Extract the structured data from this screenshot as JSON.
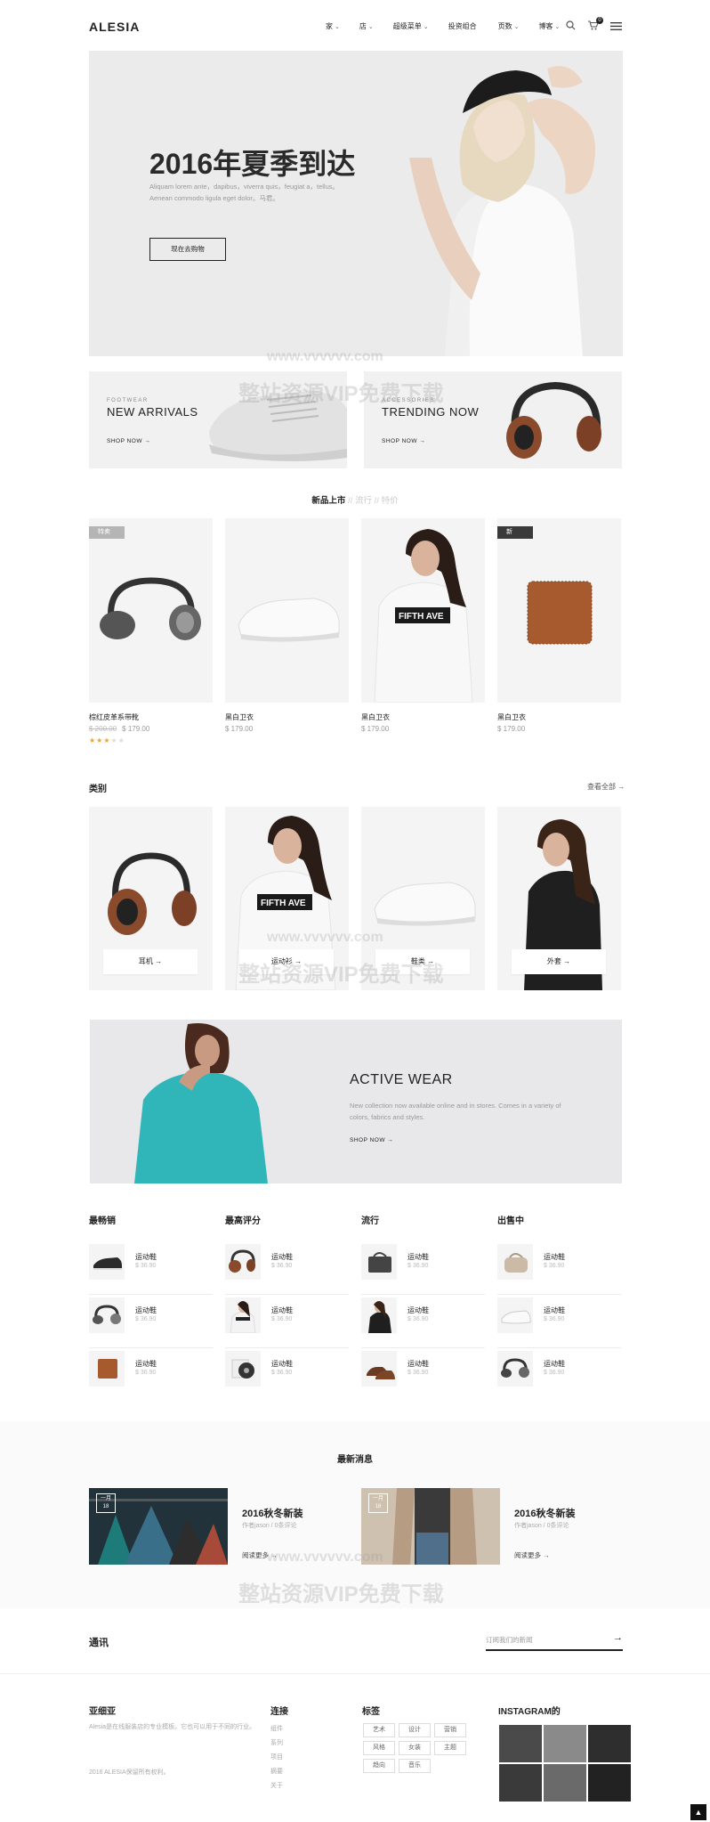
{
  "header": {
    "logo": "ALESIA",
    "nav": [
      {
        "label": "家",
        "caret": "⌄"
      },
      {
        "label": "店",
        "caret": "⌄"
      },
      {
        "label": "超级菜单",
        "caret": "⌄"
      },
      {
        "label": "投资组合",
        "caret": ""
      },
      {
        "label": "页数",
        "caret": "⌄"
      },
      {
        "label": "博客",
        "caret": "⌄"
      }
    ],
    "cart_count": "0"
  },
  "hero": {
    "title": "2016年夏季到达",
    "text": "Aliquam lorem ante，dapibus，viverra quis，feugiat a，tellus。Aenean commodo ligula eget dolor。马君。",
    "button": "现在去购物"
  },
  "banners": [
    {
      "small": "FOOTWEAR",
      "title": "NEW ARRIVALS",
      "shop": "SHOP NOW →"
    },
    {
      "small": "ACCESSORIES",
      "title": "TRENDING NOW",
      "shop": "SHOP NOW →"
    }
  ],
  "product_tabs": {
    "active": "新品上市",
    "sep1": "//",
    "tab2": "流行",
    "sep2": "//",
    "tab3": "特价"
  },
  "products": [
    {
      "tag": "特卖",
      "tag_color": "#b5b5b5",
      "name": "棕红皮革系带靴",
      "old_price": "$ 200.00",
      "price": "$ 179.00",
      "rating": 3
    },
    {
      "tag": "",
      "name": "黑白卫衣",
      "old_price": "",
      "price": "$ 179.00"
    },
    {
      "tag": "",
      "name": "黑白卫衣",
      "old_price": "",
      "price": "$ 179.00"
    },
    {
      "tag": "新",
      "tag_color": "#3a3a3a",
      "name": "黑白卫衣",
      "old_price": "",
      "price": "$ 179.00"
    }
  ],
  "categories": {
    "title": "类别",
    "view_all": "查看全部 →",
    "items": [
      {
        "label": "耳机  →"
      },
      {
        "label": "运动衫  →"
      },
      {
        "label": "鞋类  →"
      },
      {
        "label": "外套  →"
      }
    ]
  },
  "active_wear": {
    "title": "ACTIVE WEAR",
    "text": "New collection now available online and in stores. Comes in a variety of colors, fabrics and styles.",
    "shop": "SHOP NOW →"
  },
  "columns": [
    {
      "title": "最畅销",
      "items": [
        {
          "name": "运动鞋",
          "price": "$ 36.90"
        },
        {
          "name": "运动鞋",
          "price": "$ 36.90"
        },
        {
          "name": "运动鞋",
          "price": "$ 36.90"
        }
      ]
    },
    {
      "title": "最高评分",
      "items": [
        {
          "name": "运动鞋",
          "price": "$ 36.90"
        },
        {
          "name": "运动鞋",
          "price": "$ 36.90"
        },
        {
          "name": "运动鞋",
          "price": "$ 36.90"
        }
      ]
    },
    {
      "title": "流行",
      "items": [
        {
          "name": "运动鞋",
          "price": "$ 36.90"
        },
        {
          "name": "运动鞋",
          "price": "$ 36.90"
        },
        {
          "name": "运动鞋",
          "price": "$ 36.90"
        }
      ]
    },
    {
      "title": "出售中",
      "items": [
        {
          "name": "运动鞋",
          "price": "$ 36.90"
        },
        {
          "name": "运动鞋",
          "price": "$ 36.90"
        },
        {
          "name": "运动鞋",
          "price": "$ 36.90"
        }
      ]
    }
  ],
  "news": {
    "title": "最新消息",
    "posts": [
      {
        "month": "一月",
        "day": "18",
        "title": "2016秋冬新装",
        "by": "作者jason / 0条评论",
        "more": "阅读更多  →"
      },
      {
        "month": "一月",
        "day": "18",
        "title": "2016秋冬新装",
        "by": "作者jason / 0条评论",
        "more": "阅读更多  →"
      }
    ]
  },
  "newsletter": {
    "title": "通讯",
    "placeholder": "订阅我们的新闻",
    "arrow": "→"
  },
  "footer": {
    "about_title": "亚细亚",
    "about_text": "Alesia是在线服装店的专业模板。它也可以用于不同的行业。",
    "copyright": "2016 ALESIA保留所有权利。",
    "links_title": "连接",
    "links": [
      "组件",
      "系列",
      "项目",
      "摘要",
      "关于"
    ],
    "tags_title": "标签",
    "tags": [
      "艺术",
      "设计",
      "营销",
      "风格",
      "女装",
      "主题",
      "趋向",
      "音乐"
    ],
    "instagram_title": "INSTAGRAM的"
  },
  "watermark": {
    "url": "www.vvvvvv.com",
    "text": "整站资源VIP免费下载"
  }
}
